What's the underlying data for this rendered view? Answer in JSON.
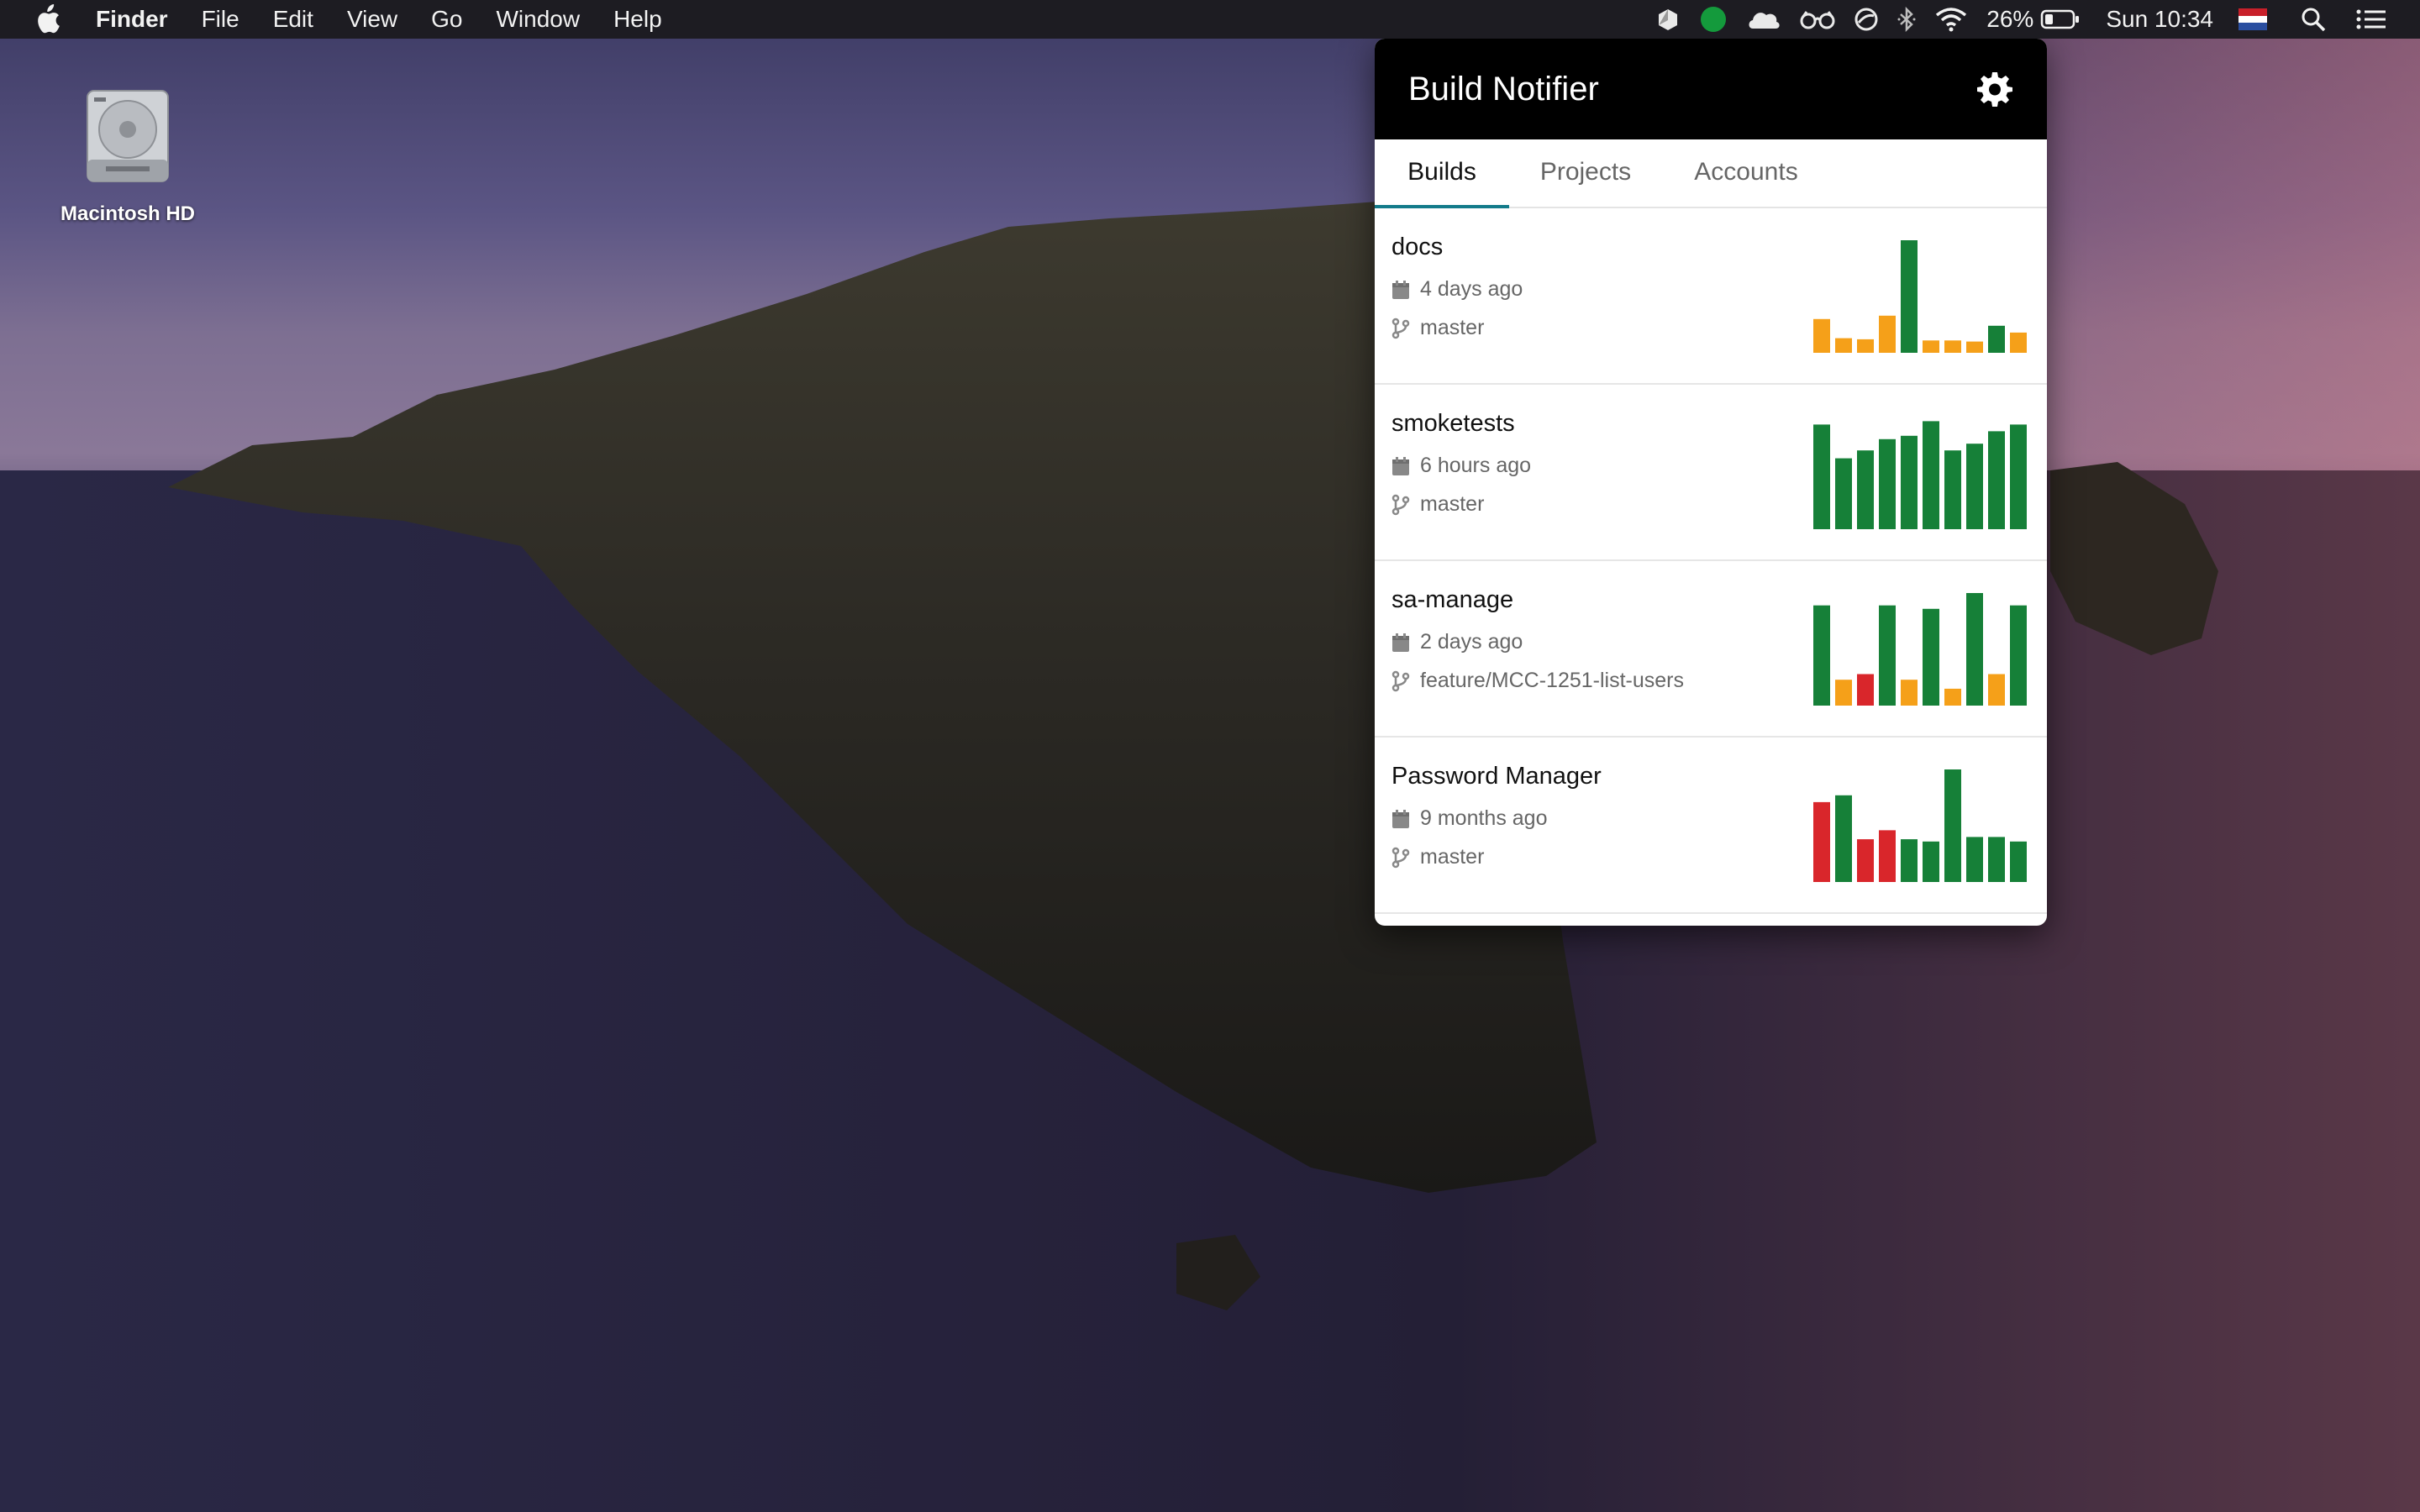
{
  "menubar": {
    "app_name": "Finder",
    "menus": [
      "File",
      "Edit",
      "View",
      "Go",
      "Window",
      "Help"
    ],
    "battery": "26%",
    "clock": "Sun 10:34",
    "tray_icons": [
      "dropbox-icon",
      "status-dot-icon",
      "cloud-icon",
      "glasses-icon",
      "no-entry-icon",
      "bluetooth-icon",
      "wifi-icon",
      "battery-icon",
      "flag-nl-icon",
      "spotlight-icon",
      "notification-center-icon"
    ]
  },
  "desktop": {
    "disk_label": "Macintosh HD"
  },
  "popover": {
    "title": "Build Notifier",
    "tabs": [
      "Builds",
      "Projects",
      "Accounts"
    ],
    "active_tab": "Builds",
    "colors": {
      "success": "#168038",
      "warning": "#f5a019",
      "failure": "#d9262b",
      "accent": "#137b8a"
    },
    "builds": [
      {
        "name": "docs",
        "date": "4 days ago",
        "branch": "master",
        "history": [
          {
            "v": 0.3,
            "s": "warning"
          },
          {
            "v": 0.13,
            "s": "warning"
          },
          {
            "v": 0.12,
            "s": "warning"
          },
          {
            "v": 0.33,
            "s": "warning"
          },
          {
            "v": 1.0,
            "s": "success"
          },
          {
            "v": 0.11,
            "s": "warning"
          },
          {
            "v": 0.11,
            "s": "warning"
          },
          {
            "v": 0.1,
            "s": "warning"
          },
          {
            "v": 0.24,
            "s": "success"
          },
          {
            "v": 0.18,
            "s": "warning"
          }
        ]
      },
      {
        "name": "smoketests",
        "date": "6 hours ago",
        "branch": "master",
        "history": [
          {
            "v": 0.93,
            "s": "success"
          },
          {
            "v": 0.63,
            "s": "success"
          },
          {
            "v": 0.7,
            "s": "success"
          },
          {
            "v": 0.8,
            "s": "success"
          },
          {
            "v": 0.83,
            "s": "success"
          },
          {
            "v": 0.96,
            "s": "success"
          },
          {
            "v": 0.7,
            "s": "success"
          },
          {
            "v": 0.76,
            "s": "success"
          },
          {
            "v": 0.87,
            "s": "success"
          },
          {
            "v": 0.93,
            "s": "success"
          }
        ]
      },
      {
        "name": "sa-manage",
        "date": "2 days ago",
        "branch": "feature/MCC-1251-list-users",
        "history": [
          {
            "v": 0.89,
            "s": "success"
          },
          {
            "v": 0.23,
            "s": "warning"
          },
          {
            "v": 0.28,
            "s": "failure"
          },
          {
            "v": 0.89,
            "s": "success"
          },
          {
            "v": 0.23,
            "s": "warning"
          },
          {
            "v": 0.86,
            "s": "success"
          },
          {
            "v": 0.15,
            "s": "warning"
          },
          {
            "v": 1.0,
            "s": "success"
          },
          {
            "v": 0.28,
            "s": "warning"
          },
          {
            "v": 0.89,
            "s": "success"
          }
        ]
      },
      {
        "name": "Password Manager",
        "date": "9 months ago",
        "branch": "master",
        "history": [
          {
            "v": 0.71,
            "s": "failure"
          },
          {
            "v": 0.77,
            "s": "success"
          },
          {
            "v": 0.38,
            "s": "failure"
          },
          {
            "v": 0.46,
            "s": "failure"
          },
          {
            "v": 0.38,
            "s": "success"
          },
          {
            "v": 0.36,
            "s": "success"
          },
          {
            "v": 1.0,
            "s": "success"
          },
          {
            "v": 0.4,
            "s": "success"
          },
          {
            "v": 0.4,
            "s": "success"
          },
          {
            "v": 0.36,
            "s": "success"
          }
        ]
      }
    ]
  }
}
